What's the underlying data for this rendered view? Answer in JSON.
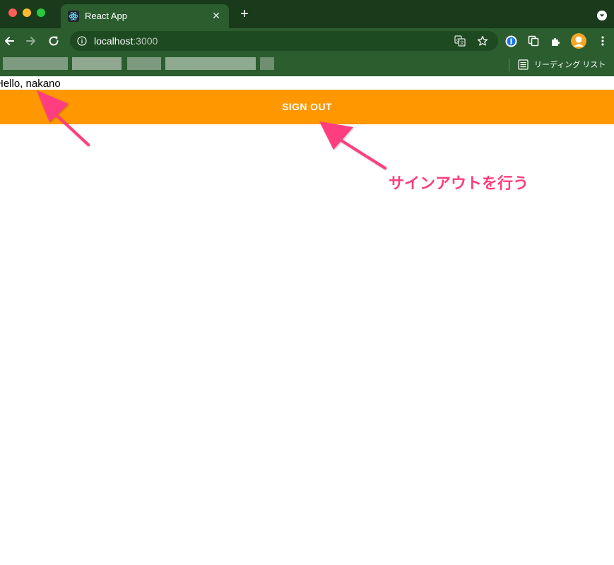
{
  "browser": {
    "tab": {
      "title": "React App",
      "close_icon": "close-icon",
      "favicon_icon": "react-logo-icon"
    },
    "new_tab_icon": "plus-icon",
    "tab_menu_icon": "chevron-down-icon",
    "address_bar": {
      "host": "localhost",
      "port": ":3000",
      "info_icon": "info-icon"
    },
    "toolbar_icons": [
      "back-arrow-icon",
      "forward-arrow-icon",
      "reload-icon",
      "translate-icon",
      "star-icon",
      "password-manager-icon",
      "copy-icon",
      "extensions-puzzle-icon",
      "profile-avatar-icon",
      "kebab-menu-icon"
    ],
    "bookmarks_bar": {
      "reading_list_label": "リーディング リスト",
      "reading_list_icon": "reading-list-icon"
    },
    "colors": {
      "frame": "#1a3a1c",
      "toolbar": "#2b5d2e",
      "omnibox": "#1e4a21"
    }
  },
  "page": {
    "greeting": "Hello, nakano",
    "sign_out_label": "SIGN OUT",
    "sign_out_color": "#ff9800"
  },
  "annotation": {
    "label": "サインアウトを行う",
    "color": "#ff3d7f"
  }
}
